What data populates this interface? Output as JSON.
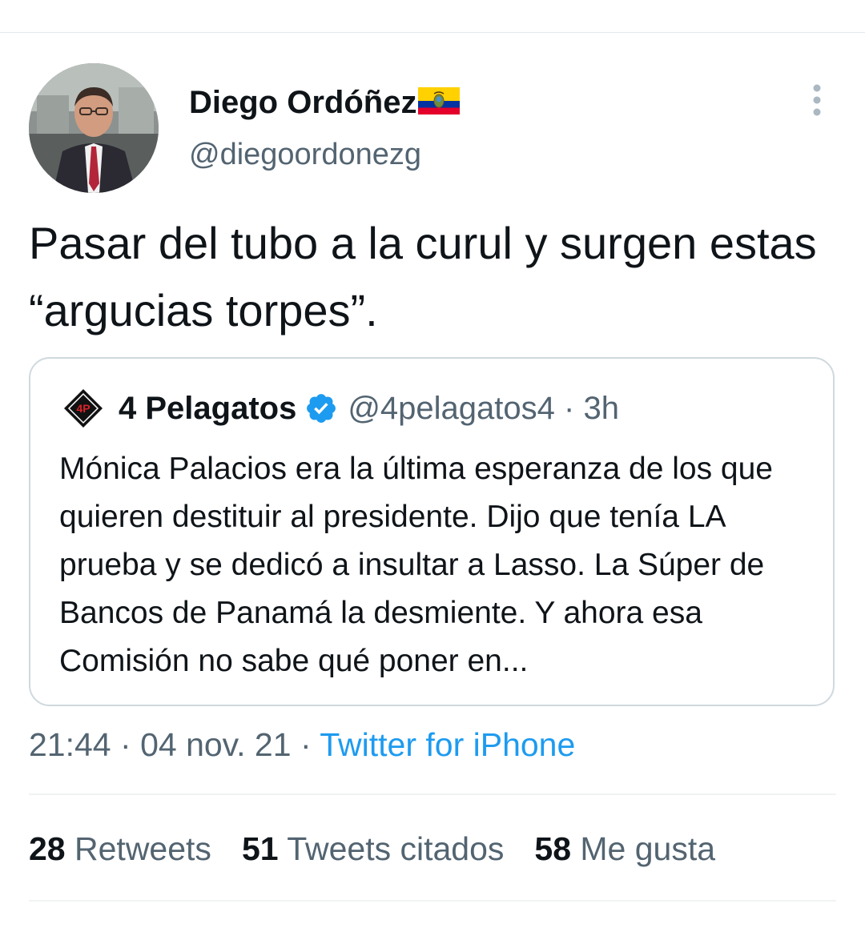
{
  "tweet": {
    "author_name": "Diego Ordóñez",
    "author_handle": "@diegoordonezg",
    "text": "Pasar del tubo a la curul y surgen estas “argucias torpes”.",
    "time": "21:44",
    "separator": "·",
    "date": "04 nov. 21",
    "source": "Twitter for iPhone"
  },
  "quote": {
    "name": "4 Pelagatos",
    "handle": "@4pelagatos4",
    "separator": "·",
    "age": "3h",
    "text": "Mónica Palacios era la última esperanza de los que quieren destituir al presidente. Dijo que tenía LA prueba y se dedicó a insultar a Lasso. La Súper de Bancos de Panamá la desmiente. Y ahora esa Comisión no sabe qué poner en...",
    "logo_text": "4P"
  },
  "stats": {
    "retweets_count": "28",
    "retweets_label": "Retweets",
    "quotes_count": "51",
    "quotes_label": "Tweets citados",
    "likes_count": "58",
    "likes_label": "Me gusta"
  },
  "icons": {
    "flag": "ecuador-flag-icon",
    "verified": "verified-badge-icon",
    "more": "more-options-icon"
  },
  "colors": {
    "text": "#0f1419",
    "secondary": "#536471",
    "link": "#1d9bf0",
    "border": "#cfd9de",
    "verified": "#1d9bf0"
  }
}
